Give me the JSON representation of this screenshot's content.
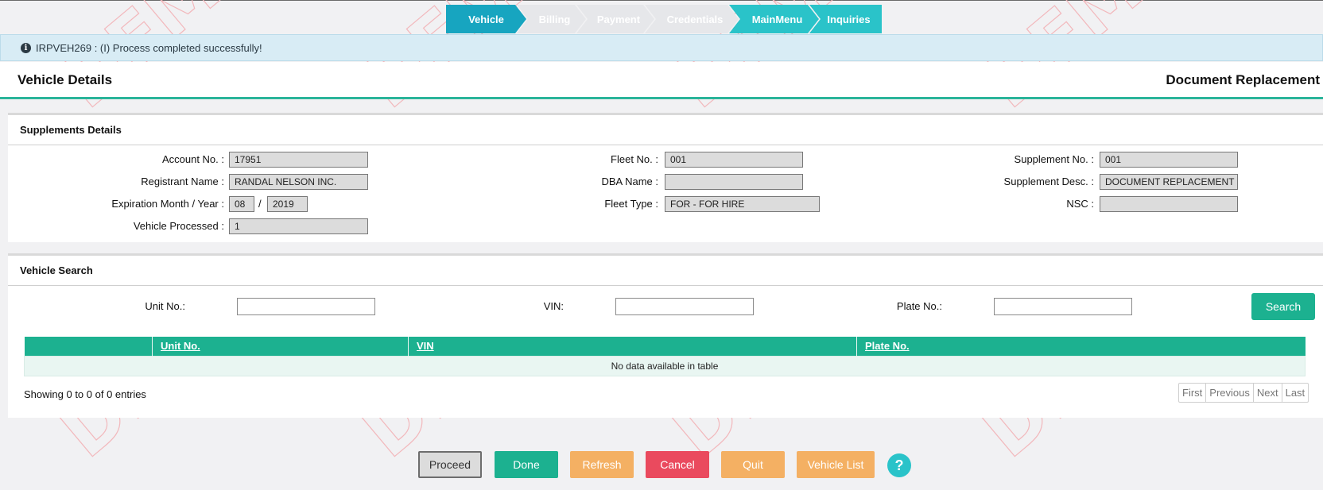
{
  "steps": [
    "Vehicle",
    "Billing",
    "Payment",
    "Credentials",
    "MainMenu",
    "Inquiries"
  ],
  "message": "IRPVEH269 : (I) Process completed successfully!",
  "header": {
    "title": "Vehicle Details",
    "right": "Document Replacement"
  },
  "supplements": {
    "title": "Supplements Details",
    "account_label": "Account No. :",
    "account_value": "17951",
    "registrant_label": "Registrant Name :",
    "registrant_value": "RANDAL NELSON INC.",
    "expiration_label": "Expiration Month / Year :",
    "exp_month": "08",
    "exp_sep": "/",
    "exp_year": "2019",
    "vehicle_processed_label": "Vehicle Processed :",
    "vehicle_processed_value": "1",
    "fleet_label": "Fleet No. :",
    "fleet_value": "001",
    "dba_label": "DBA Name :",
    "dba_value": "",
    "fleet_type_label": "Fleet Type :",
    "fleet_type_value": "FOR - FOR HIRE",
    "supp_no_label": "Supplement No. :",
    "supp_no_value": "001",
    "supp_desc_label": "Supplement Desc. :",
    "supp_desc_value": "DOCUMENT REPLACEMENT",
    "nsc_label": "NSC :",
    "nsc_value": ""
  },
  "search": {
    "title": "Vehicle Search",
    "unit_label": "Unit No.:",
    "unit_value": "",
    "vin_label": "VIN:",
    "vin_value": "",
    "plate_label": "Plate No.:",
    "plate_value": "",
    "search_button": "Search"
  },
  "table": {
    "columns": [
      "",
      "Unit No.",
      "VIN",
      "Plate No."
    ],
    "empty": "No data available in table",
    "showing": "Showing 0 to 0 of 0 entries",
    "pager": [
      "First",
      "Previous",
      "Next",
      "Last"
    ]
  },
  "buttons": {
    "proceed": "Proceed",
    "done": "Done",
    "refresh": "Refresh",
    "cancel": "Cancel",
    "quit": "Quit",
    "vehicle_list": "Vehicle List",
    "help": "?"
  },
  "colors": {
    "teal": "#1cb190",
    "active_step": "#17a5c0",
    "cancel": "#ea4a5e",
    "orange": "#f4b063"
  }
}
